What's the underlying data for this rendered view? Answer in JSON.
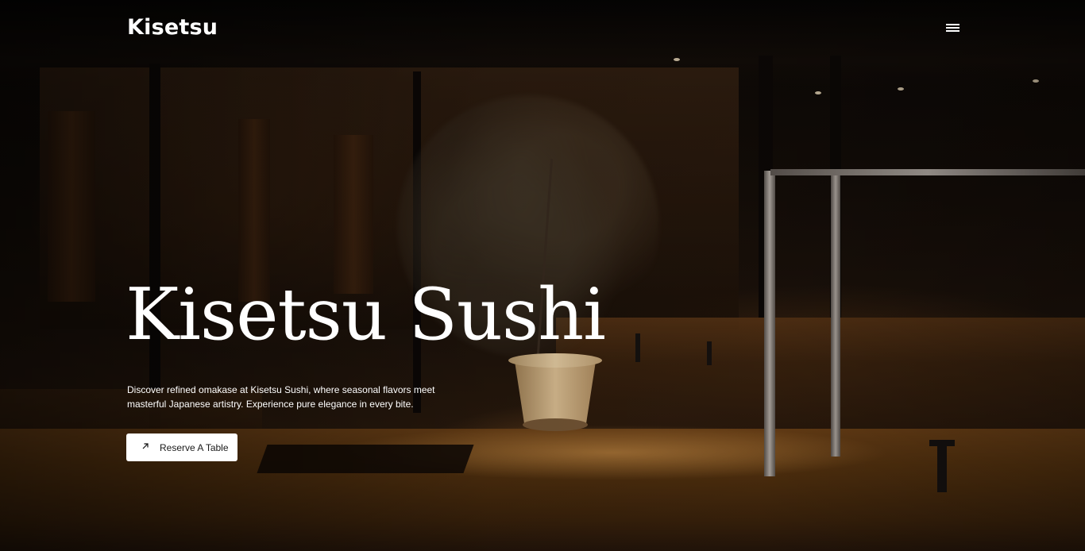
{
  "header": {
    "logo_text": "Kisetsu",
    "menu_icon": "hamburger-menu-icon"
  },
  "hero": {
    "title": "Kisetsu Sushi",
    "description": "Discover refined omakase at Kisetsu Sushi, where seasonal flavors meet masterful Japanese artistry. Experience pure elegance in every bite.",
    "cta": {
      "label": "Reserve A Table",
      "icon": "arrow-up-right-icon"
    }
  },
  "colors": {
    "text": "#ffffff",
    "button_bg": "#ffffff",
    "button_text": "#1a1a1a",
    "background": "#0b0806"
  }
}
